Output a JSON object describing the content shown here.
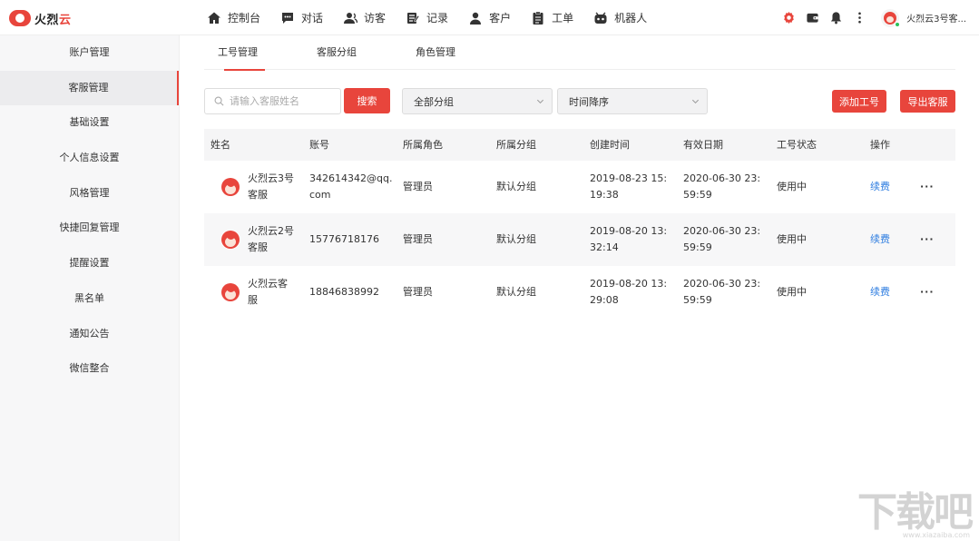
{
  "brand": {
    "name_part1": "火烈",
    "name_part2": "云"
  },
  "nav": [
    {
      "label": "控制台",
      "icon": "home-icon"
    },
    {
      "label": "对话",
      "icon": "chat-icon"
    },
    {
      "label": "访客",
      "icon": "visitor-icon"
    },
    {
      "label": "记录",
      "icon": "record-icon"
    },
    {
      "label": "客户",
      "icon": "customer-icon"
    },
    {
      "label": "工单",
      "icon": "ticket-icon"
    },
    {
      "label": "机器人",
      "icon": "robot-icon"
    }
  ],
  "user": {
    "name": "火烈云3号客..."
  },
  "sidebar": {
    "items": [
      {
        "label": "账户管理"
      },
      {
        "label": "客服管理"
      },
      {
        "label": "基础设置"
      },
      {
        "label": "个人信息设置"
      },
      {
        "label": "风格管理"
      },
      {
        "label": "快捷回复管理"
      },
      {
        "label": "提醒设置"
      },
      {
        "label": "黑名单"
      },
      {
        "label": "通知公告"
      },
      {
        "label": "微信整合"
      }
    ]
  },
  "tabs": [
    {
      "label": "工号管理"
    },
    {
      "label": "客服分组"
    },
    {
      "label": "角色管理"
    }
  ],
  "toolbar": {
    "search_placeholder": "请输入客服姓名",
    "search_button": "搜索",
    "group_select": "全部分组",
    "sort_select": "时间降序",
    "add_button": "添加工号",
    "export_button": "导出客服"
  },
  "table": {
    "headers": [
      "姓名",
      "账号",
      "所属角色",
      "所属分组",
      "创建时间",
      "有效日期",
      "工号状态",
      "操作"
    ],
    "rows": [
      {
        "name": "火烈云3号客服",
        "account": "342614342@qq.com",
        "role": "管理员",
        "group": "默认分组",
        "created": "2019-08-23 15:19:38",
        "valid": "2020-06-30 23:59:59",
        "status": "使用中",
        "action": "续费",
        "more": "···"
      },
      {
        "name": "火烈云2号客服",
        "account": "15776718176",
        "role": "管理员",
        "group": "默认分组",
        "created": "2019-08-20 13:32:14",
        "valid": "2020-06-30 23:59:59",
        "status": "使用中",
        "action": "续费",
        "more": "···"
      },
      {
        "name": "火烈云客服",
        "account": "18846838992",
        "role": "管理员",
        "group": "默认分组",
        "created": "2019-08-20 13:29:08",
        "valid": "2020-06-30 23:59:59",
        "status": "使用中",
        "action": "续费",
        "more": "···"
      }
    ]
  },
  "watermark": {
    "text": "下载吧",
    "sub": "www.xiazaiba.com"
  },
  "colors": {
    "accent": "#e8453c",
    "link": "#2e7de0",
    "online": "#2bc25a"
  }
}
